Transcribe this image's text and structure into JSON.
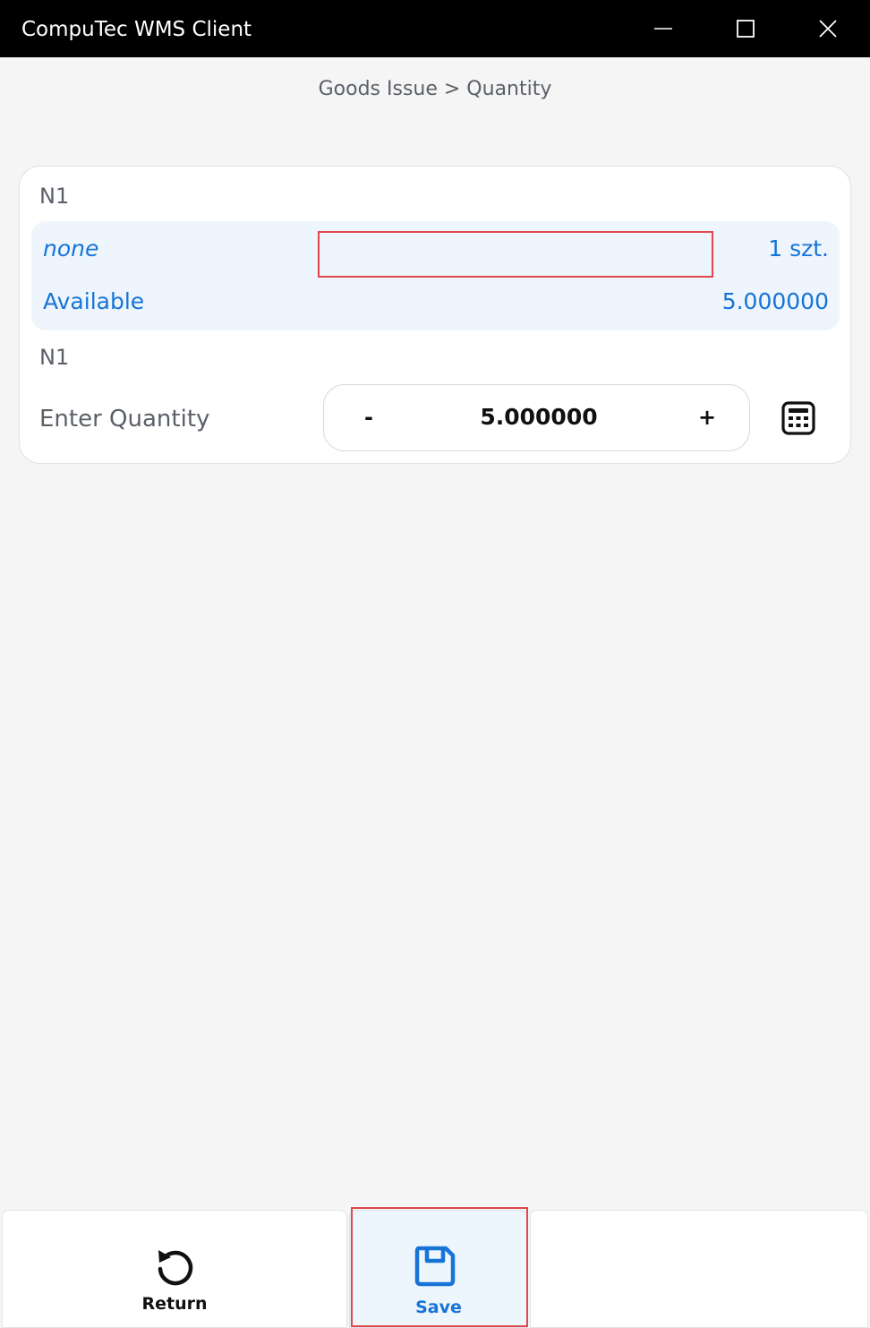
{
  "window": {
    "title": "CompuTec WMS Client"
  },
  "breadcrumb": "Goods Issue > Quantity",
  "card": {
    "item_code": "N1",
    "batch": "none",
    "uom": "1 szt.",
    "available_label": "Available",
    "available_value": "5.000000",
    "item_code_2": "N1",
    "quantity_label": "Enter Quantity",
    "quantity": {
      "value": "5.000000",
      "minus": "-",
      "plus": "+"
    },
    "calculator_icon": "calculator-icon"
  },
  "bottom_bar": {
    "return_label": "Return",
    "return_icon": "refresh-icon",
    "save_label": "Save",
    "save_icon": "floppy-disk-icon"
  },
  "colors": {
    "accent": "#1674d6",
    "highlight": "#e0474f",
    "titlebar": "#000000",
    "info_bg": "#eef5fc"
  }
}
